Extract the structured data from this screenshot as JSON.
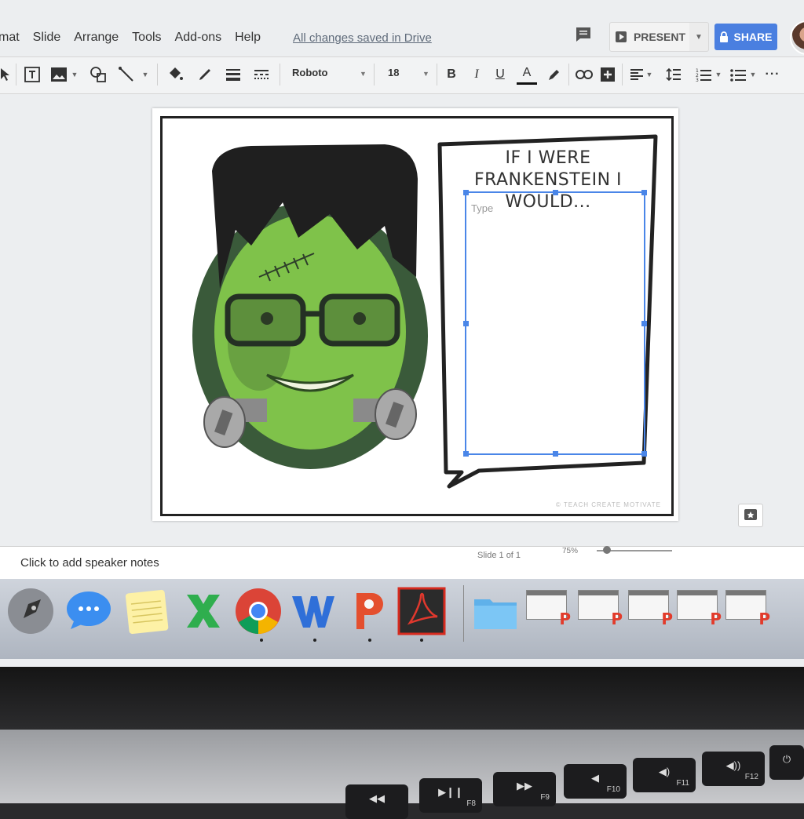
{
  "menu": {
    "items": [
      "mat",
      "Slide",
      "Arrange",
      "Tools",
      "Add-ons",
      "Help"
    ],
    "save_status": "All changes saved in Drive"
  },
  "header": {
    "present_label": "PRESENT",
    "share_label": "SHARE"
  },
  "toolbar": {
    "font_name": "Roboto",
    "font_size": "18",
    "bold": "B",
    "italic": "I",
    "underline": "U",
    "text_color": "A"
  },
  "slide": {
    "bubble_title_line1": "IF I WERE FRANKENSTEIN I",
    "bubble_title_line2": "WOULD...",
    "textbox_placeholder": "Type",
    "watermark": "© TEACH CREATE MOTIVATE"
  },
  "notes": {
    "placeholder": "Click to add speaker notes"
  },
  "status": {
    "slide_count": "Slide 1 of 1",
    "zoom": "75%"
  },
  "dock": {
    "apps": [
      "launchpad-icon",
      "messages-icon",
      "notes-icon",
      "excel-icon",
      "chrome-icon",
      "word-icon",
      "powerpoint-icon",
      "acrobat-icon"
    ],
    "folder": "folder-icon"
  },
  "keyboard": {
    "keys": [
      "F8",
      "F9",
      "F10",
      "F11",
      "F12"
    ]
  },
  "colors": {
    "accent_blue": "#4a7fe0",
    "selection_blue": "#4a86e8",
    "monster_green": "#7fc24a",
    "hair": "#1f1f1f"
  }
}
